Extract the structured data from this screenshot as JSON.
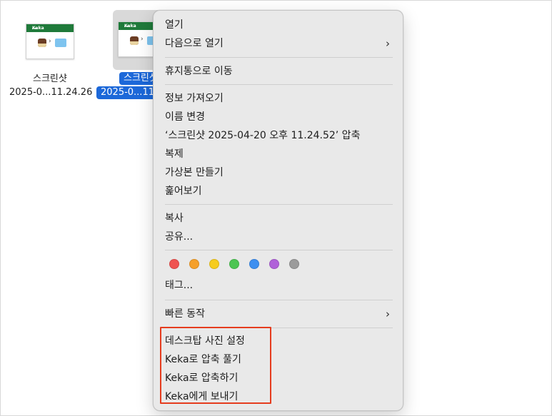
{
  "files": [
    {
      "name_line1": "스크린샷",
      "name_line2": "2025-0...11.24.26",
      "selected": false,
      "thumb_title": "Keka"
    },
    {
      "name_line1": "스크린샷",
      "name_line2": "2025-0...11",
      "selected": true,
      "thumb_title": "Keka"
    }
  ],
  "menu": {
    "group1": [
      {
        "label": "열기"
      },
      {
        "label": "다음으로 열기",
        "submenu": true
      }
    ],
    "group2": [
      {
        "label": "휴지통으로 이동"
      }
    ],
    "group3": [
      {
        "label": "정보 가져오기"
      },
      {
        "label": "이름 변경"
      },
      {
        "label": "‘스크린샷 2025-04-20 오후 11.24.52’ 압축"
      },
      {
        "label": "복제"
      },
      {
        "label": "가상본 만들기"
      },
      {
        "label": "훑어보기"
      }
    ],
    "group4": [
      {
        "label": "복사"
      },
      {
        "label": "공유..."
      }
    ],
    "tags": {
      "colors": [
        "#ef5350",
        "#f5a02a",
        "#f6cc1f",
        "#4cc552",
        "#3d8ff0",
        "#b062d9",
        "#9b9b9b"
      ],
      "label": "태그..."
    },
    "group5": [
      {
        "label": "빠른 동작",
        "submenu": true
      }
    ],
    "group6": [
      {
        "label": "데스크탑 사진 설정"
      },
      {
        "label": "Keka로 압축 풀기"
      },
      {
        "label": "Keka로 압축하기"
      },
      {
        "label": "Keka에게 보내기"
      }
    ],
    "chevron": "›",
    "highlight_color": "#e53c1e"
  }
}
